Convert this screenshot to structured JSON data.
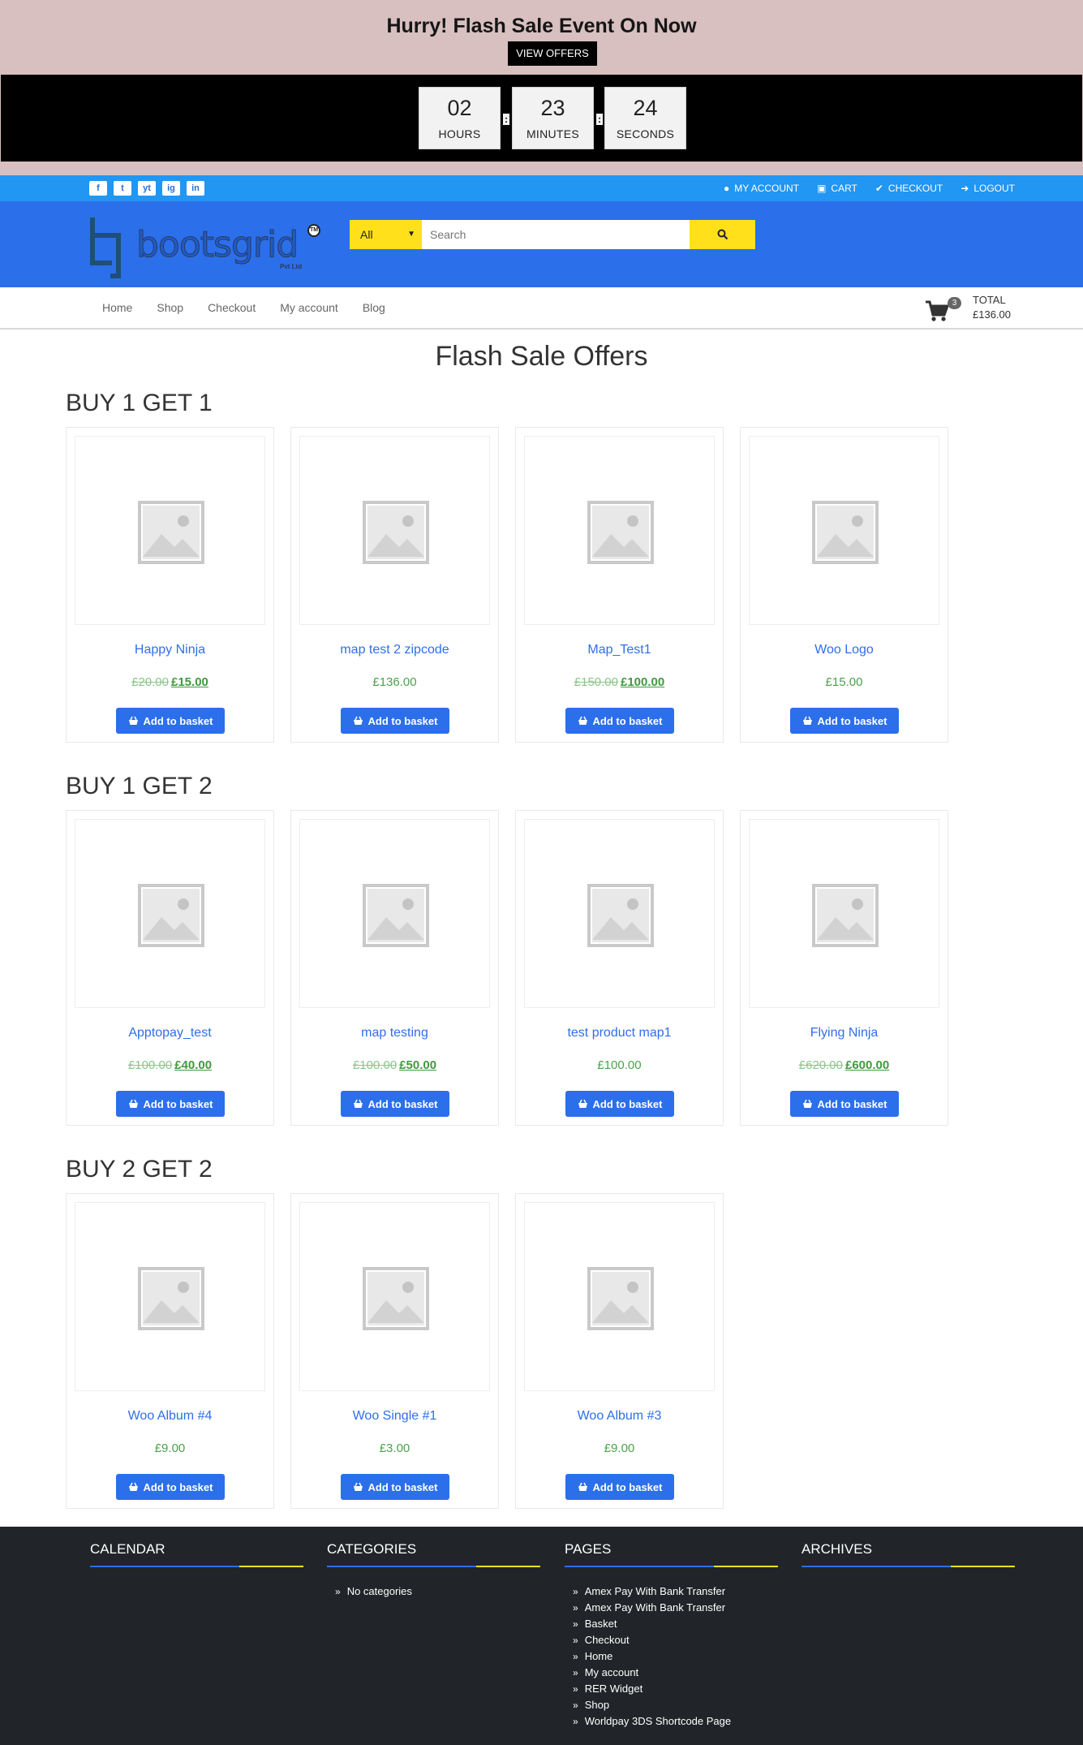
{
  "flash": {
    "title": "Hurry! Flash Sale Event On Now",
    "button": "VIEW OFFERS",
    "countdown": [
      {
        "value": "02",
        "label": "HOURS"
      },
      {
        "value": "23",
        "label": "MINUTES"
      },
      {
        "value": "24",
        "label": "SECONDS"
      }
    ],
    "separator": ":"
  },
  "topbar": {
    "social": [
      "f",
      "t",
      "yt",
      "ig",
      "in"
    ],
    "links": {
      "account": "MY ACCOUNT",
      "cart": "CART",
      "checkout": "CHECKOUT",
      "logout": "LOGOUT"
    }
  },
  "header": {
    "logo_text": "bootsgrid",
    "logo_sub": "Pvt Ltd",
    "logo_tm": "TM",
    "search_category": "All",
    "search_placeholder": "Search"
  },
  "nav": {
    "items": [
      "Home",
      "Shop",
      "Checkout",
      "My account",
      "Blog"
    ],
    "cart_count": "3",
    "total_label": "TOTAL",
    "total_value": "£136.00"
  },
  "main": {
    "title": "Flash Sale Offers",
    "button_label": "Add to basket",
    "sections": [
      {
        "title": "BUY 1 GET 1",
        "products": [
          {
            "name": "Happy Ninja",
            "old_price": "£20.00",
            "price": "£15.00"
          },
          {
            "name": "map test 2 zipcode",
            "old_price": "",
            "price": "£136.00"
          },
          {
            "name": "Map_Test1",
            "old_price": "£150.00",
            "price": "£100.00"
          },
          {
            "name": "Woo Logo",
            "old_price": "",
            "price": "£15.00"
          }
        ]
      },
      {
        "title": "BUY 1 GET 2",
        "products": [
          {
            "name": "Apptopay_test",
            "old_price": "£100.00",
            "price": "£40.00"
          },
          {
            "name": "map testing",
            "old_price": "£100.00",
            "price": "£50.00"
          },
          {
            "name": "test product map1",
            "old_price": "",
            "price": "£100.00"
          },
          {
            "name": "Flying Ninja",
            "old_price": "£620.00",
            "price": "£600.00"
          }
        ]
      },
      {
        "title": "BUY 2 GET 2",
        "products": [
          {
            "name": "Woo Album #4",
            "old_price": "",
            "price": "£9.00"
          },
          {
            "name": "Woo Single #1",
            "old_price": "",
            "price": "£3.00"
          },
          {
            "name": "Woo Album #3",
            "old_price": "",
            "price": "£9.00"
          }
        ]
      }
    ]
  },
  "footer": {
    "calendar": {
      "title": "CALENDAR"
    },
    "categories": {
      "title": "CATEGORIES",
      "items": [
        "No categories"
      ]
    },
    "pages": {
      "title": "PAGES",
      "items": [
        "Amex Pay With Bank Transfer",
        "Amex Pay With Bank Transfer",
        "Basket",
        "Checkout",
        "Home",
        "My account",
        "RER Widget",
        "Shop",
        "Worldpay 3DS Shortcode Page"
      ]
    },
    "archives": {
      "title": "ARCHIVES"
    }
  },
  "colors": {
    "banner_bg": "#d7c0bf",
    "topbar_bg": "#2196f3",
    "header_bg": "#2c6fea",
    "accent_yellow": "#ffe01b",
    "price_green": "#4ca14c",
    "footer_bg": "#212428"
  }
}
